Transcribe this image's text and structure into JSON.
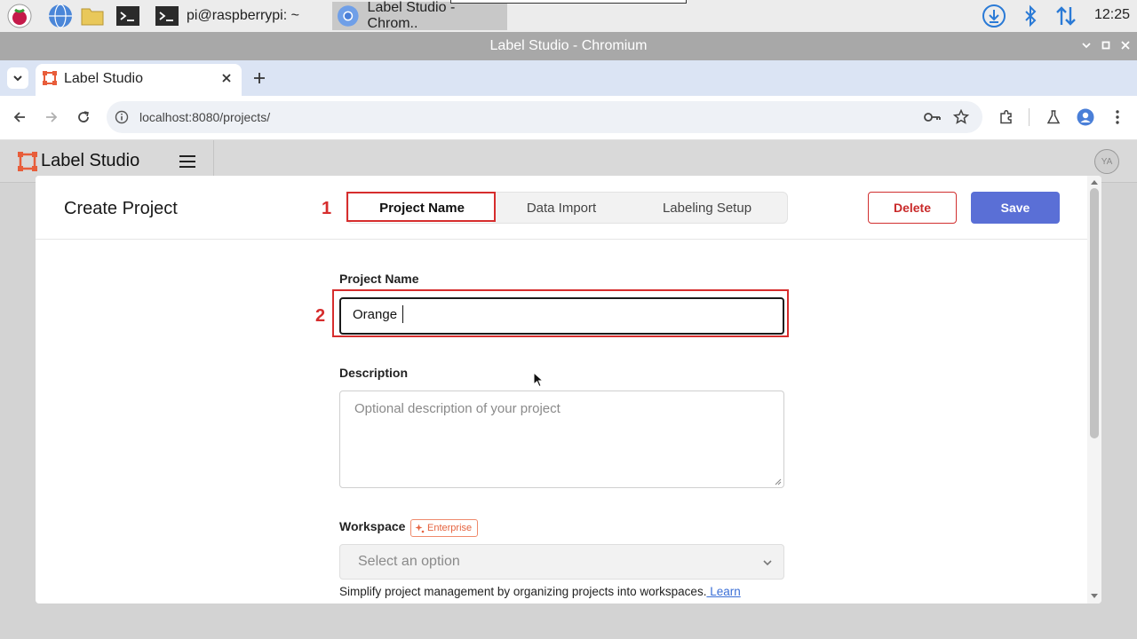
{
  "taskbar": {
    "terminal_task": "pi@raspberrypi: ~",
    "browser_task": "Label Studio - Chrom..",
    "clock": "12:25"
  },
  "window": {
    "title": "Label Studio - Chromium"
  },
  "browser": {
    "tab_title": "Label Studio",
    "url": "localhost:8080/projects/"
  },
  "app": {
    "brand": "Label Studio",
    "avatar_initials": "YA"
  },
  "modal": {
    "title": "Create Project",
    "steps": [
      "Project Name",
      "Data Import",
      "Labeling Setup"
    ],
    "active_step": "Project Name",
    "delete_label": "Delete",
    "save_label": "Save",
    "project_name_label": "Project Name",
    "project_name_value": "Orange",
    "description_label": "Description",
    "description_placeholder": "Optional description of your project",
    "workspace_label": "Workspace",
    "enterprise_badge": "Enterprise",
    "workspace_placeholder": "Select an option",
    "help_text": "Simplify project management by organizing projects into workspaces.",
    "help_link": " Learn"
  },
  "annotations": [
    "1",
    "2"
  ],
  "colors": {
    "accent": "#5a6fd6",
    "danger": "#d12f2f",
    "annotation": "#d62d2d",
    "enterprise": "#e5633f"
  }
}
